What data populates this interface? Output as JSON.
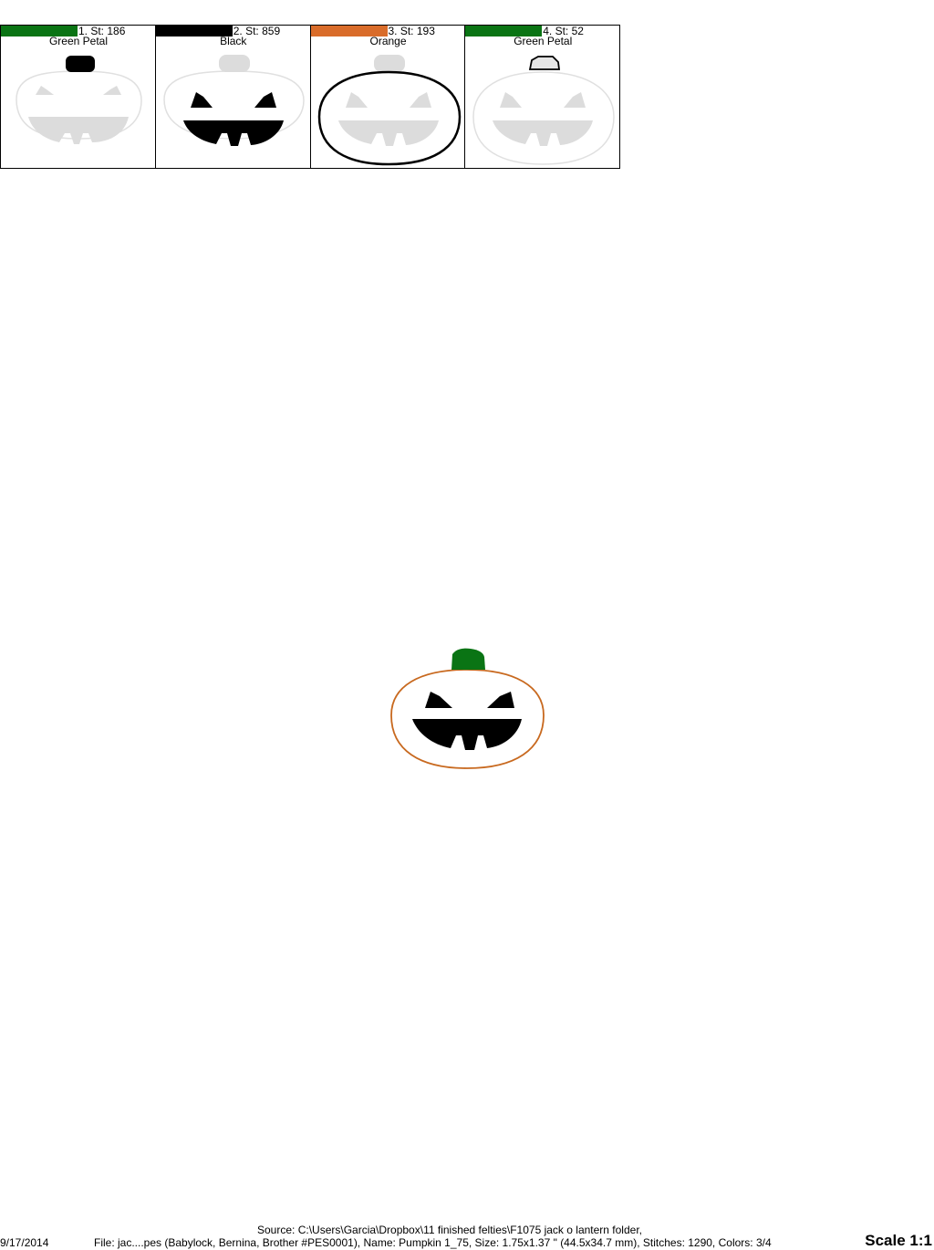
{
  "steps": [
    {
      "label": "1. St: 186",
      "color_name": "Green Petal",
      "color": "#0a7414"
    },
    {
      "label": "2. St: 859",
      "color_name": "Black",
      "color": "#000000"
    },
    {
      "label": "3. St: 193",
      "color_name": "Orange",
      "color": "#d96c2a"
    },
    {
      "label": "4. St: 52",
      "color_name": "Green Petal",
      "color": "#0a7414"
    }
  ],
  "footer": {
    "source": "Source: C:\\Users\\Garcia\\Dropbox\\11 finished felties\\F1075 jack o lantern folder,",
    "date": "9/17/2014",
    "file_info": "File: jac....pes (Babylock, Bernina, Brother #PES0001), Name: Pumpkin 1_75, Size: 1.75x1.37 \" (44.5x34.7 mm), Stitches: 1290, Colors: 3/4",
    "scale": "Scale 1:1"
  },
  "design_colors": {
    "ghost": "#d9d9d9",
    "stem": "#0a7414",
    "outline": "#c8691f",
    "face": "#000000"
  }
}
